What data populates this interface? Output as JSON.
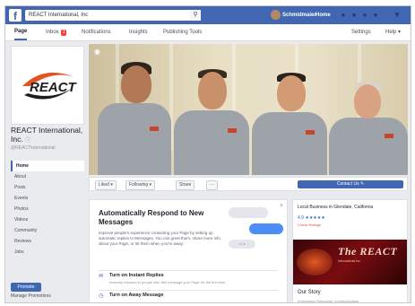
{
  "topbar": {
    "logo": "f",
    "search_value": "REACT International, Inc",
    "search_icon": "search-icon",
    "user_name": "Schmidmaier",
    "home_label": "Home",
    "icons": [
      "friend-requests-icon",
      "messages-icon",
      "notifications-icon",
      "help-icon",
      "menu-caret-icon"
    ],
    "brand_color": "#4267b2"
  },
  "tabs": [
    {
      "label": "Page",
      "active": true
    },
    {
      "label": "Inbox",
      "badge": "1"
    },
    {
      "label": "Notifications"
    },
    {
      "label": "Insights"
    },
    {
      "label": "Publishing Tools"
    },
    {
      "label": "Settings"
    },
    {
      "label": "Help ▾"
    }
  ],
  "page": {
    "name": "REACT International, Inc.",
    "handle": "@REACTInternational",
    "verified_icon": "info-icon"
  },
  "nav": [
    "Home",
    "About",
    "Posts",
    "Events",
    "Photos",
    "Videos",
    "Community",
    "Reviews",
    "Jobs"
  ],
  "promote_label": "Promote",
  "manage_label": "Manage Promotions",
  "actions": {
    "liked": "Liked ▾",
    "following": "Following ▾",
    "share": "Share",
    "more": "···",
    "contact": "Contact Us ✎"
  },
  "auto_card": {
    "title": "Automatically Respond to New Messages",
    "description": "Improve people's experience contacting your Page by setting up automatic replies to Messages. You can greet them, share more info about your Page, or let them when you're away.",
    "close": "×",
    "bubble": "• • •",
    "rows": [
      {
        "icon": "message-icon",
        "title": "Turn on Instant Replies",
        "subtitle": "Instantly respond to people who first message your Page for the first time."
      },
      {
        "icon": "clock-icon",
        "title": "Turn on Away Message",
        "subtitle": ""
      }
    ]
  },
  "right": {
    "category": "Local Business in Glendale, California",
    "rating": "4.9 ★★★★★",
    "rating_link": "Check Ratings",
    "banner_title": "The REACT",
    "banner_sub": "International Inc.",
    "story_title": "Our Story",
    "story_sub": "Emergency Response Communication"
  }
}
